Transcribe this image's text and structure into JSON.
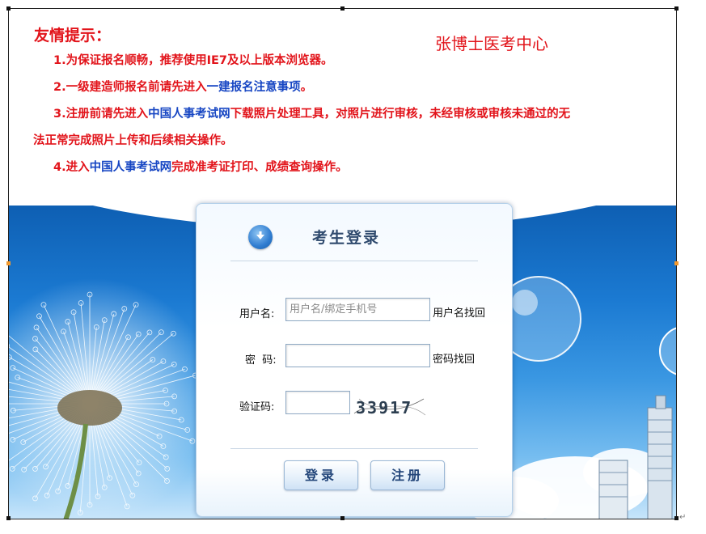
{
  "notice": {
    "title": "友情提示：",
    "watermark": "张博士医考中心",
    "tip1": "1.为保证报名顺畅，推荐使用IE7及以上版本浏览器。",
    "tip2_a": "2.一级建造师报名前请先进入",
    "tip2_link": "一建报名注意事项",
    "tip2_b": "。",
    "tip3_a": "3.注册前请先进入",
    "tip3_link": "中国人事考试网",
    "tip3_b": "下载照片处理工具，对照片进行审核，未经审核或审核未通过的无",
    "tip3_c": "法正常完成照片上传和后续相关操作。",
    "tip4_a": "4.进入",
    "tip4_link": "中国人事考试网",
    "tip4_b": "完成准考证打印、成绩查询操作。"
  },
  "login": {
    "title": "考生登录",
    "username_label": "用户名:",
    "username_placeholder": "用户名/绑定手机号",
    "username_value": "",
    "username_recover": "用户名找回",
    "password_label": "密  码:",
    "password_value": "",
    "password_recover": "密码找回",
    "captcha_label": "验证码:",
    "captcha_value": "",
    "captcha_text": "33917",
    "login_button": "登录",
    "register_button": "注册"
  },
  "colors": {
    "notice_red": "#e2141b",
    "link_blue": "#1746c3",
    "panel_title": "#2f4a6e",
    "sky_blue": "#1b7ad2"
  },
  "icons": [
    "download-arrow-icon"
  ]
}
